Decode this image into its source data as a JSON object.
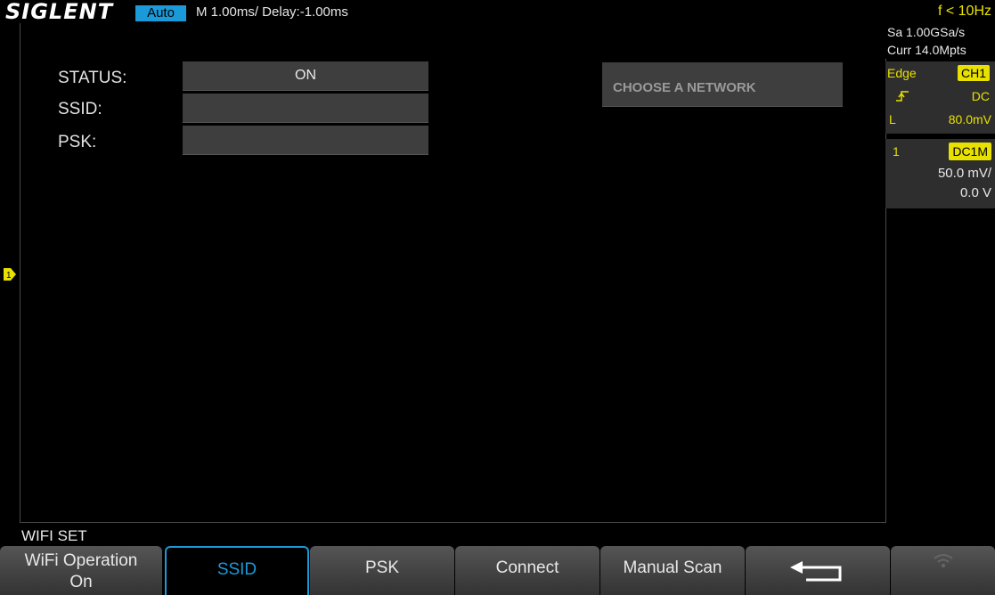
{
  "top_bar": {
    "logo": "SIGLENT",
    "mode": "Auto",
    "timebase": "M 1.00ms/ Delay:-1.00ms",
    "frequency": "f < 10Hz"
  },
  "wifi_form": {
    "status_label": "STATUS:",
    "status_value": "ON",
    "ssid_label": "SSID:",
    "ssid_value": "",
    "psk_label": "PSK:",
    "psk_value": "",
    "network_button": "CHOOSE A NETWORK"
  },
  "info_panel": {
    "sample_rate": "Sa 1.00GSa/s",
    "memory_depth": "Curr 14.0Mpts",
    "trigger_type": "Edge",
    "trigger_source": "CH1",
    "trigger_coupling": "DC",
    "trigger_level_label": "L",
    "trigger_level": "80.0mV",
    "channel_number": "1",
    "channel_coupling": "DC1M",
    "channel_scale": "50.0 mV/",
    "channel_offset": "0.0 V"
  },
  "trigger_marker": "1",
  "menu": {
    "title": "WIFI SET",
    "softkeys": [
      {
        "line1": "WiFi Operation",
        "line2": "On"
      },
      {
        "label": "SSID"
      },
      {
        "label": "PSK"
      },
      {
        "label": "Connect"
      },
      {
        "label": "Manual Scan"
      },
      {
        "icon": "return-arrow-icon"
      },
      {
        "icon": "wifi-icon"
      }
    ]
  },
  "colors": {
    "accent_blue": "#1a9ad8",
    "channel_yellow": "#e8e100",
    "field_bg": "#3e3e3e"
  }
}
